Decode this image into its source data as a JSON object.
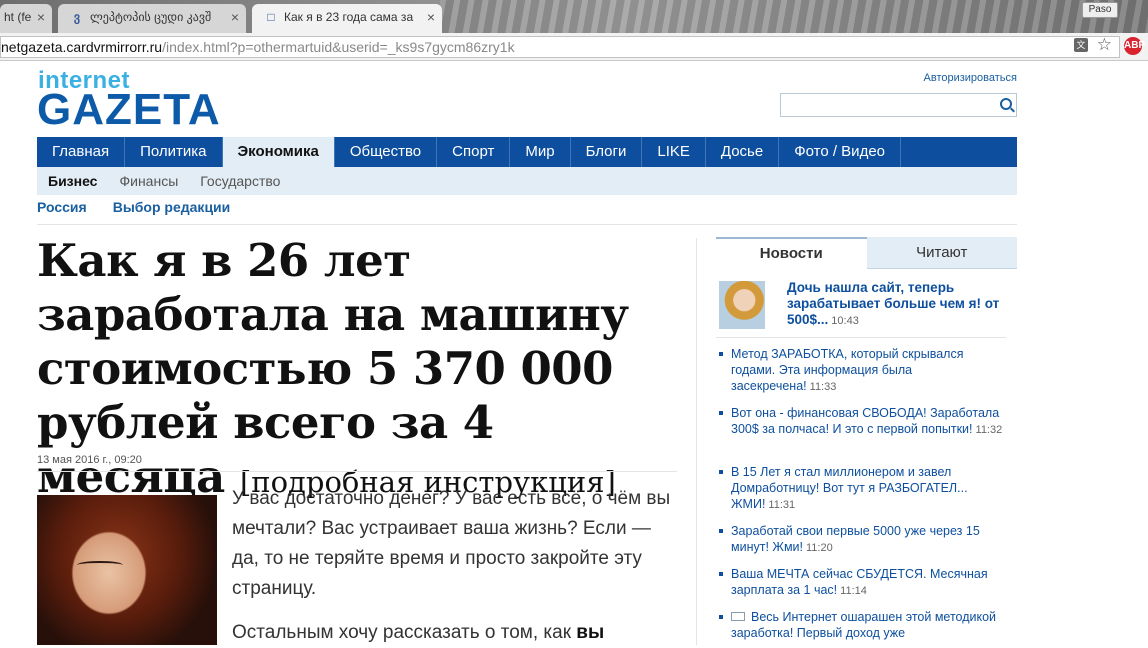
{
  "browser": {
    "tabs": [
      {
        "title": "ht (fe",
        "icon": "",
        "active": false
      },
      {
        "title": "ლეპტოპის ცუდი კავშ",
        "icon": "ვ",
        "active": false
      },
      {
        "title": "Как я в 23 года сама за",
        "icon": "",
        "active": true
      }
    ],
    "window_button": "Paso",
    "url_host": "netgazeta.cardvrmirrorr.ru",
    "url_path": "/index.html?p=othermartuid&userid=_ks9s7gycm86zry1k",
    "extension_icon_text": "ABP"
  },
  "header": {
    "logo_top": "internet",
    "logo_main": "GAZETA",
    "login_link": "Авторизироваться",
    "search_placeholder": ""
  },
  "nav": {
    "main": [
      {
        "label": "Главная",
        "active": false
      },
      {
        "label": "Политика",
        "active": false
      },
      {
        "label": "Экономика",
        "active": true
      },
      {
        "label": "Общество",
        "active": false
      },
      {
        "label": "Спорт",
        "active": false
      },
      {
        "label": "Мир",
        "active": false
      },
      {
        "label": "Блоги",
        "active": false
      },
      {
        "label": "LIKE",
        "active": false
      },
      {
        "label": "Досье",
        "active": false
      },
      {
        "label": "Фото / Видео",
        "active": false
      }
    ],
    "sub": [
      {
        "label": "Бизнес",
        "active": true
      },
      {
        "label": "Финансы",
        "active": false
      },
      {
        "label": "Государство",
        "active": false
      }
    ],
    "tags": [
      "Россия",
      "Выбор редакции"
    ]
  },
  "article": {
    "headline": "Как я в 26 лет заработала на машину стоимостью 5 370 000 рублей всего за 4 месяца",
    "headline_suffix": "[подробная инструкция]",
    "date": "13 мая 2016 г., 09:20",
    "para1": "У вас достаточно денег? У вас есть всё, о чём вы мечтали? Вас устраивает ваша жизнь? Если — да, то не теряйте время и просто закройте эту страницу.",
    "para2_start": "Остальным хочу рассказать о том, как",
    "para2_bold": "вы"
  },
  "sidebar": {
    "tabs": [
      {
        "label": "Новости",
        "active": true
      },
      {
        "label": "Читают",
        "active": false
      }
    ],
    "featured": {
      "title": "Дочь нашла сайт, теперь зарабатывает больше чем я! от 500$...",
      "time": "10:43"
    },
    "news": [
      {
        "title": "Метод ЗАРАБОТКА, который скрывался годами. Эта информация была засекречена!",
        "time": "11:33"
      },
      {
        "title": "Вот она - финансовая СВОБОДА! Заработала 300$ за полчаса! И это с первой попытки!",
        "time": "11:32"
      },
      {
        "title": "В 15 Лет я стал миллионером и завел Домработницу! Вот тут я РАЗБОГАТЕЛ... ЖМИ!",
        "time": "11:31"
      },
      {
        "title": "Заработай свои первые 5000 уже через 15 минут! Жми!",
        "time": "11:20"
      },
      {
        "title": "Ваша МЕЧТА сейчас СБУДЕТСЯ. Месячная зарплата за 1 час!",
        "time": "11:14"
      },
      {
        "title": "Весь Интернет ошарашен этой методикой заработка! Первый доход уже",
        "time": ""
      }
    ]
  }
}
